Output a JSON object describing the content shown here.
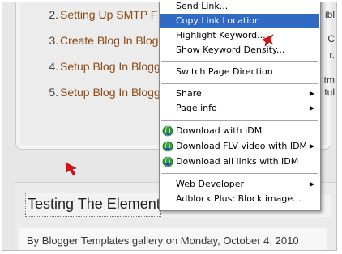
{
  "list_items": [
    {
      "num": "2.",
      "text": "Setting Up SMTP F"
    },
    {
      "num": "3.",
      "text": "Create Blog In Blog"
    },
    {
      "num": "4.",
      "text": "Setup Blog In Blogg"
    },
    {
      "num": "5.",
      "text": "Setup Blog In Blogg"
    }
  ],
  "edge_fragments": [
    "ibl",
    "C",
    "r.",
    "tm",
    "tul"
  ],
  "post": {
    "title": "Testing The Elements",
    "byline": "By Blogger Templates gallery on Monday, October 4, 2010"
  },
  "context_menu": {
    "items": [
      {
        "label": "Send Link...",
        "highlighted": false
      },
      {
        "label": "Copy Link Location",
        "highlighted": true
      },
      {
        "label": "Highlight Keyword...",
        "highlighted": false
      },
      {
        "label": "Show Keyword Density...",
        "highlighted": false
      },
      {
        "label": "Switch Page Direction",
        "highlighted": false
      },
      {
        "label": "Share",
        "highlighted": false,
        "submenu": true
      },
      {
        "label": "Page info",
        "highlighted": false,
        "submenu": true
      },
      {
        "label": "Download with IDM",
        "highlighted": false,
        "icon": "idm-download-icon"
      },
      {
        "label": "Download FLV video with IDM",
        "highlighted": false,
        "icon": "idm-download-icon",
        "submenu": true
      },
      {
        "label": "Download all links with IDM",
        "highlighted": false,
        "icon": "idm-download-icon"
      },
      {
        "label": "Web Developer",
        "highlighted": false,
        "submenu": true
      },
      {
        "label": "Adblock Plus: Block image...",
        "highlighted": false
      }
    ],
    "submenu_glyph": "▶"
  },
  "colors": {
    "highlight": "#316ac5",
    "link": "#8b4a14",
    "arrow": "#e01010"
  }
}
